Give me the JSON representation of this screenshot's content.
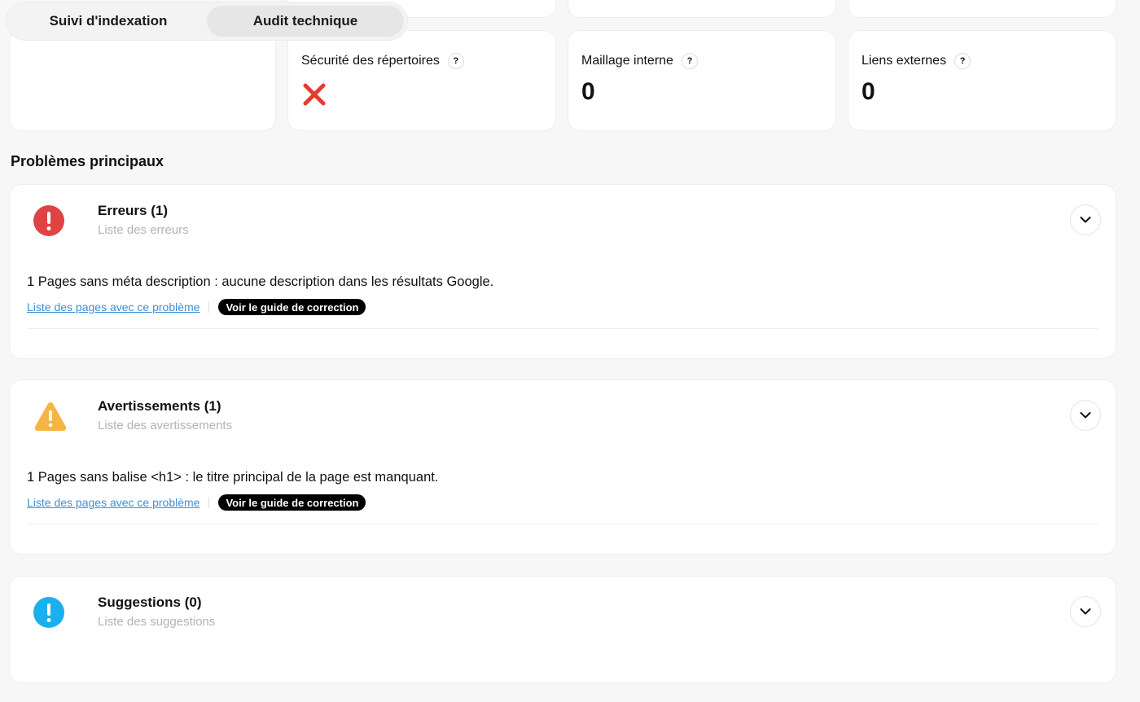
{
  "tabs": [
    {
      "label": "Suivi d'indexation",
      "active": false
    },
    {
      "label": "Audit technique",
      "active": true
    }
  ],
  "stats": {
    "security": {
      "label": "Sécurité des répertoires",
      "help": "?",
      "status": "fail"
    },
    "internal_links": {
      "label": "Maillage interne",
      "help": "?",
      "value": "0"
    },
    "external_links": {
      "label": "Liens externes",
      "help": "?",
      "value": "0"
    }
  },
  "section_title": "Problèmes principaux",
  "issues": {
    "errors": {
      "title": "Erreurs (1)",
      "subtitle": "Liste des erreurs",
      "color": "#e04343",
      "item_text": "1 Pages sans méta description : aucune description dans les résultats Google.",
      "link_label": "Liste des pages avec ce problème",
      "guide_label": "Voir le guide de correction"
    },
    "warnings": {
      "title": "Avertissements (1)",
      "subtitle": "Liste des avertissements",
      "color": "#f7b446",
      "item_text": "1 Pages sans balise <h1> : le titre principal de la page est manquant.",
      "link_label": "Liste des pages avec ce problème",
      "guide_label": "Voir le guide de correction"
    },
    "suggestions": {
      "title": "Suggestions (0)",
      "subtitle": "Liste des suggestions",
      "color": "#1ab0f0"
    }
  }
}
